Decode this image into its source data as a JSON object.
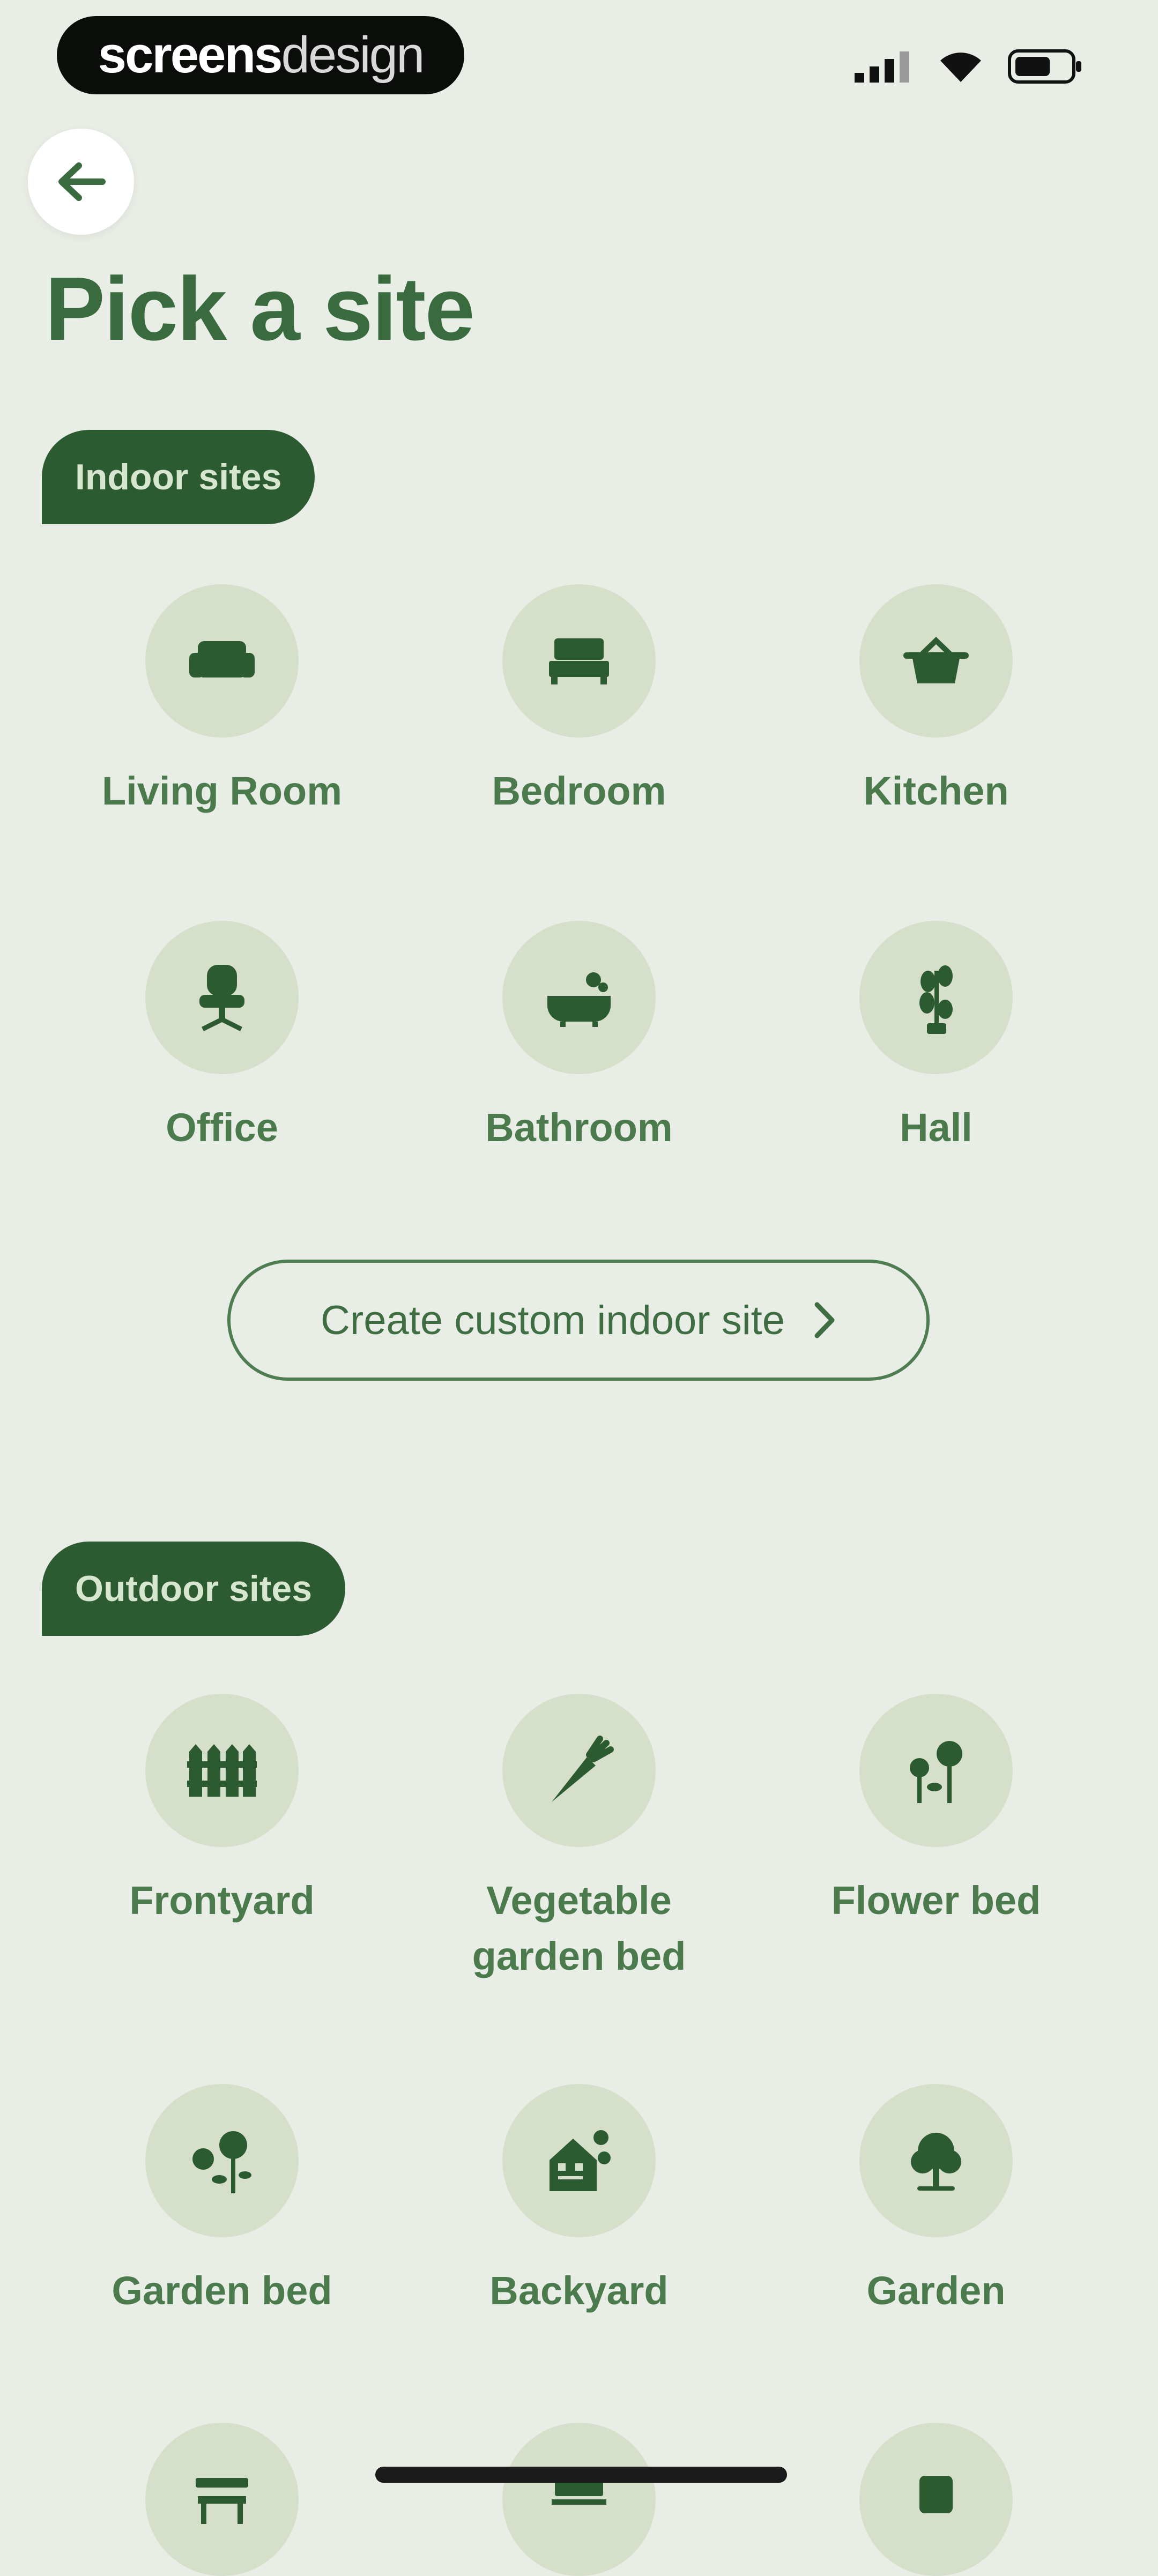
{
  "status_bar": {
    "brand_bold": "screens",
    "brand_thin": "design",
    "icons": [
      "signal-icon",
      "wifi-icon",
      "battery-icon"
    ]
  },
  "header": {
    "back_icon": "arrow-left-icon",
    "title": "Pick a site"
  },
  "indoor": {
    "section_label": "Indoor sites",
    "items": [
      {
        "label": "Living Room",
        "icon": "sofa-icon"
      },
      {
        "label": "Bedroom",
        "icon": "bed-icon"
      },
      {
        "label": "Kitchen",
        "icon": "pot-icon"
      },
      {
        "label": "Office",
        "icon": "office-chair-icon"
      },
      {
        "label": "Bathroom",
        "icon": "bathtub-icon"
      },
      {
        "label": "Hall",
        "icon": "hall-plant-icon"
      }
    ],
    "custom_button_label": "Create custom indoor site"
  },
  "outdoor": {
    "section_label": "Outdoor sites",
    "items": [
      {
        "label": "Frontyard",
        "icon": "fence-icon"
      },
      {
        "label": "Vegetable garden bed",
        "icon": "carrot-icon"
      },
      {
        "label": "Flower bed",
        "icon": "flowers-icon"
      },
      {
        "label": "Garden bed",
        "icon": "garden-bed-icon"
      },
      {
        "label": "Backyard",
        "icon": "house-trees-icon"
      },
      {
        "label": "Garden",
        "icon": "tree-icon"
      }
    ]
  },
  "colors": {
    "background": "#e8ede5",
    "primary_dark_green": "#2d5b31",
    "icon_circle": "#d5dfca",
    "label_green": "#4b7a4d",
    "pill_text": "#d6e6cf"
  }
}
